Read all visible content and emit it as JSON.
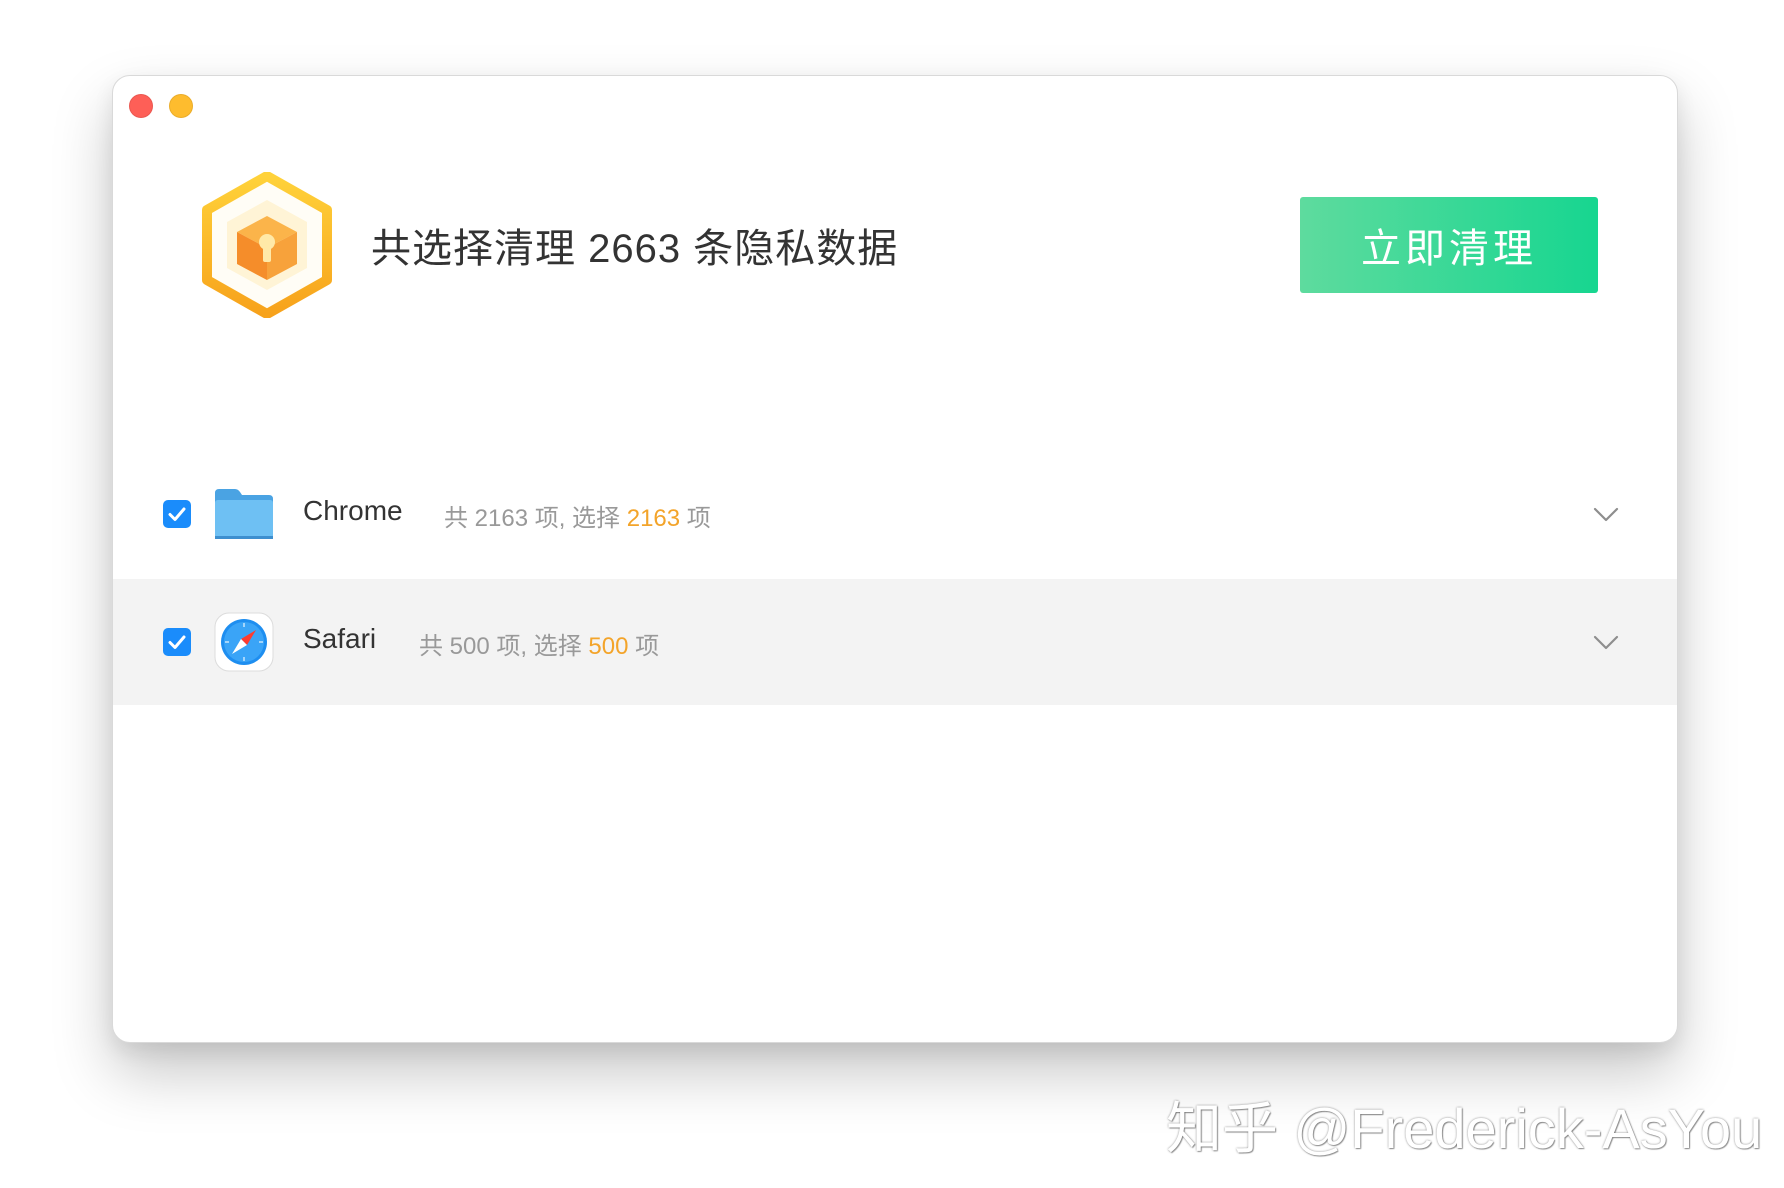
{
  "window": {
    "controls": [
      "close",
      "minimize"
    ]
  },
  "header": {
    "logo_icon": "hexagon-cube-logo-icon",
    "title": "共选择清理 2663 条隐私数据",
    "clean_button_label": "立即清理",
    "accent_color": "#1dd694"
  },
  "items": [
    {
      "name": "Chrome",
      "icon": "folder-icon",
      "checked": true,
      "summary_prefix": "共 2163 项, 选择 ",
      "selected_count": "2163",
      "summary_suffix": " 项"
    },
    {
      "name": "Safari",
      "icon": "safari-compass-icon",
      "checked": true,
      "summary_prefix": "共 500 项, 选择 ",
      "selected_count": "500",
      "summary_suffix": " 项"
    }
  ],
  "highlight_color": "#f3a42a",
  "watermark": "知乎 @Frederick-AsYou"
}
